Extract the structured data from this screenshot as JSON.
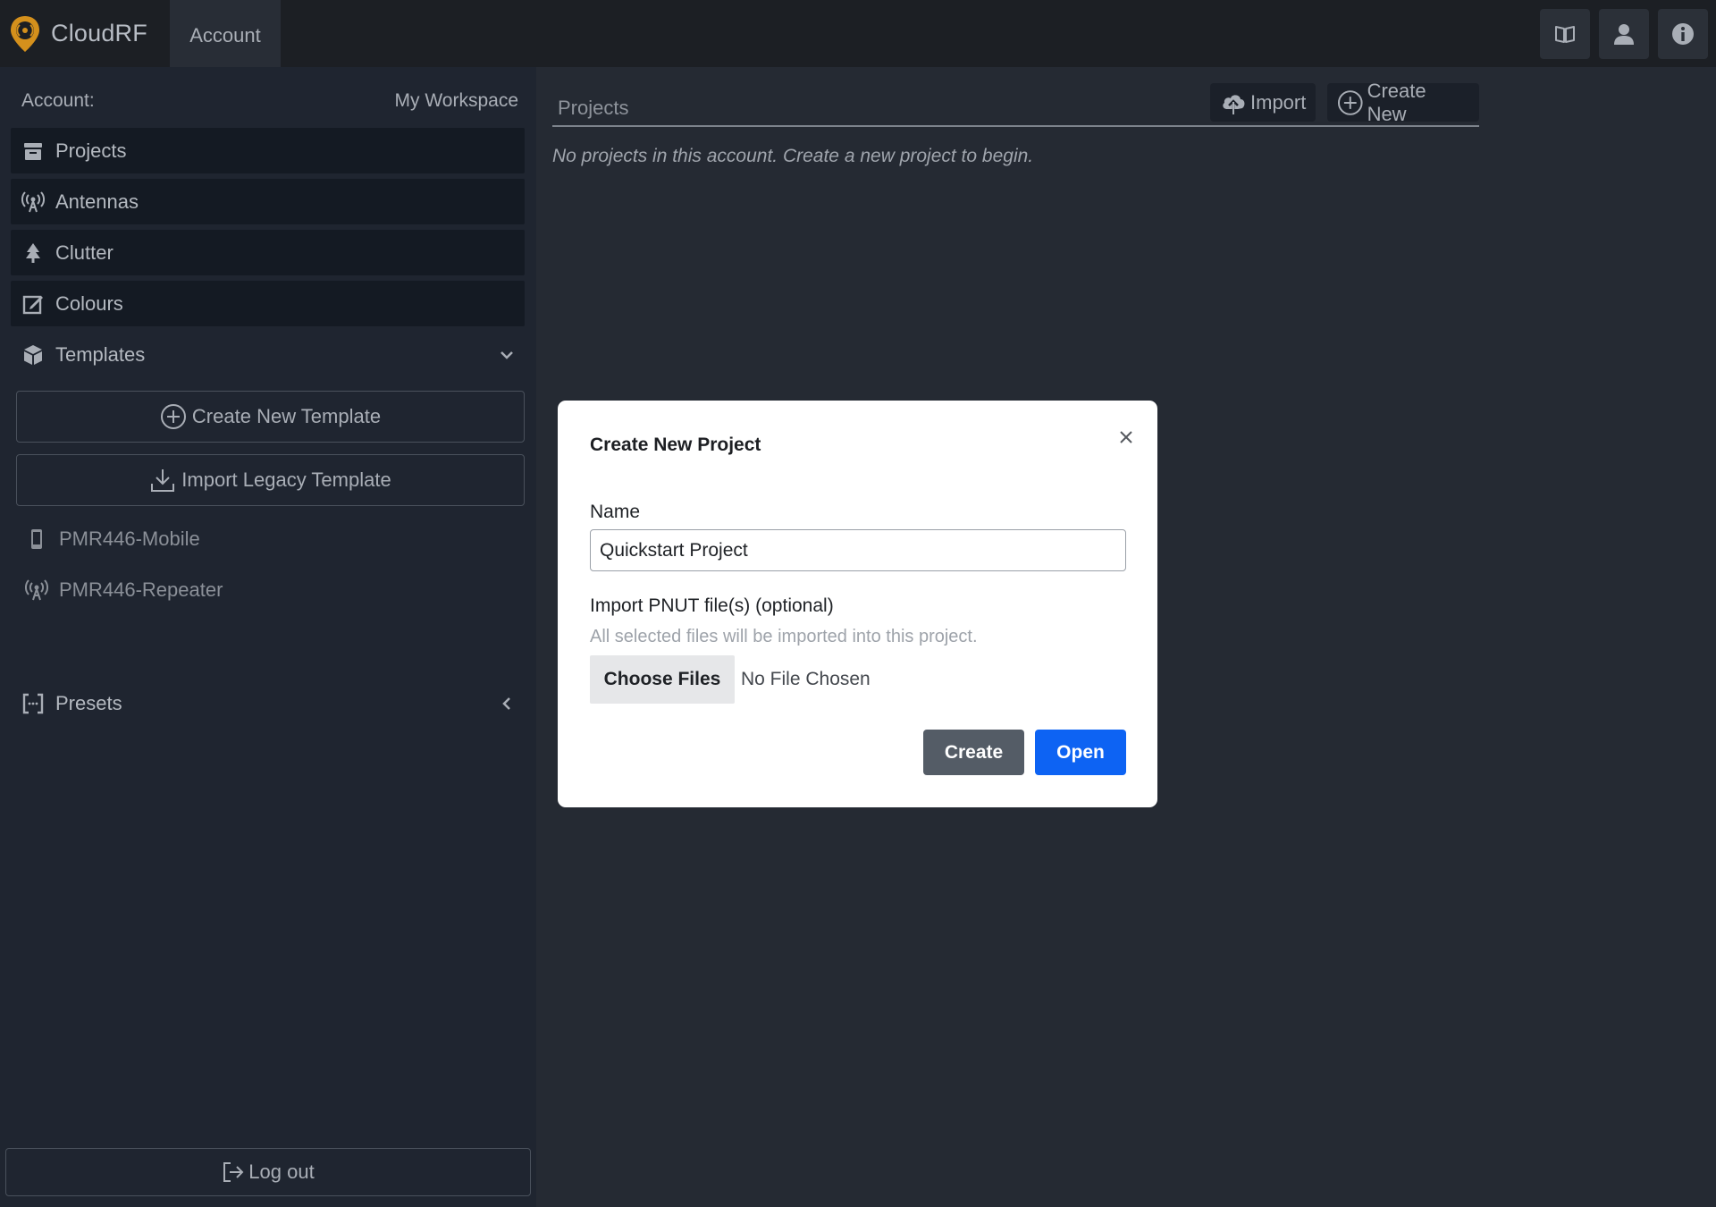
{
  "app": {
    "name": "CloudRF",
    "tab": "Account"
  },
  "topbar": {
    "icons": [
      "book-icon",
      "user-icon",
      "info-icon"
    ]
  },
  "sidebar": {
    "account_label": "Account:",
    "workspace": "My Workspace",
    "items": [
      {
        "label": "Projects",
        "icon": "archive-icon"
      },
      {
        "label": "Antennas",
        "icon": "antenna-icon"
      },
      {
        "label": "Clutter",
        "icon": "tree-icon"
      },
      {
        "label": "Colours",
        "icon": "edit-icon"
      }
    ],
    "templates": {
      "label": "Templates",
      "create_label": "Create New Template",
      "import_label": "Import Legacy Template",
      "items": [
        {
          "label": "PMR446-Mobile",
          "icon": "mobile-icon"
        },
        {
          "label": "PMR446-Repeater",
          "icon": "antenna-icon"
        }
      ]
    },
    "presets_label": "Presets",
    "logout_label": "Log out"
  },
  "main": {
    "title": "Projects",
    "import_label": "Import",
    "create_new_label": "Create New",
    "empty_message": "No projects in this account. Create a new project to begin."
  },
  "modal": {
    "title": "Create New Project",
    "name_label": "Name",
    "name_value": "Quickstart Project",
    "import_label": "Import PNUT file(s) (optional)",
    "import_hint": "All selected files will be imported into this project.",
    "choose_files_label": "Choose Files",
    "no_file_label": "No File Chosen",
    "create_label": "Create",
    "open_label": "Open"
  },
  "colors": {
    "accent": "#0d63f3",
    "logo": "#d4901c",
    "sidebar_bg": "#1f2530",
    "main_bg": "#252a33"
  }
}
